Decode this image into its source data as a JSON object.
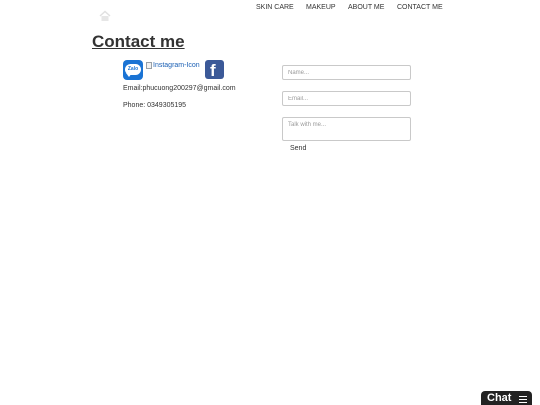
{
  "nav": {
    "home_icon": "home-icon",
    "items": [
      {
        "label": "SKIN CARE"
      },
      {
        "label": "MAKEUP"
      },
      {
        "label": "ABOUT ME"
      },
      {
        "label": "CONTACT ME"
      }
    ]
  },
  "page": {
    "title": "Contact me"
  },
  "social": {
    "zalo_label": "Zalo",
    "instagram_alt": "Instagram-Icon",
    "facebook_icon": "facebook-icon"
  },
  "contact": {
    "email": "Email:phucuong200297@gmail.com",
    "phone": "Phone: 0349305195"
  },
  "form": {
    "name_placeholder": "Name...",
    "email_placeholder": "Email...",
    "message_placeholder": "Talk with me...",
    "send_label": "Send"
  },
  "chat": {
    "label": "Chat",
    "menu_icon": "menu-icon"
  },
  "colors": {
    "zalo": "#1a73d4",
    "facebook": "#3b5998",
    "chat_bg": "#222222"
  }
}
